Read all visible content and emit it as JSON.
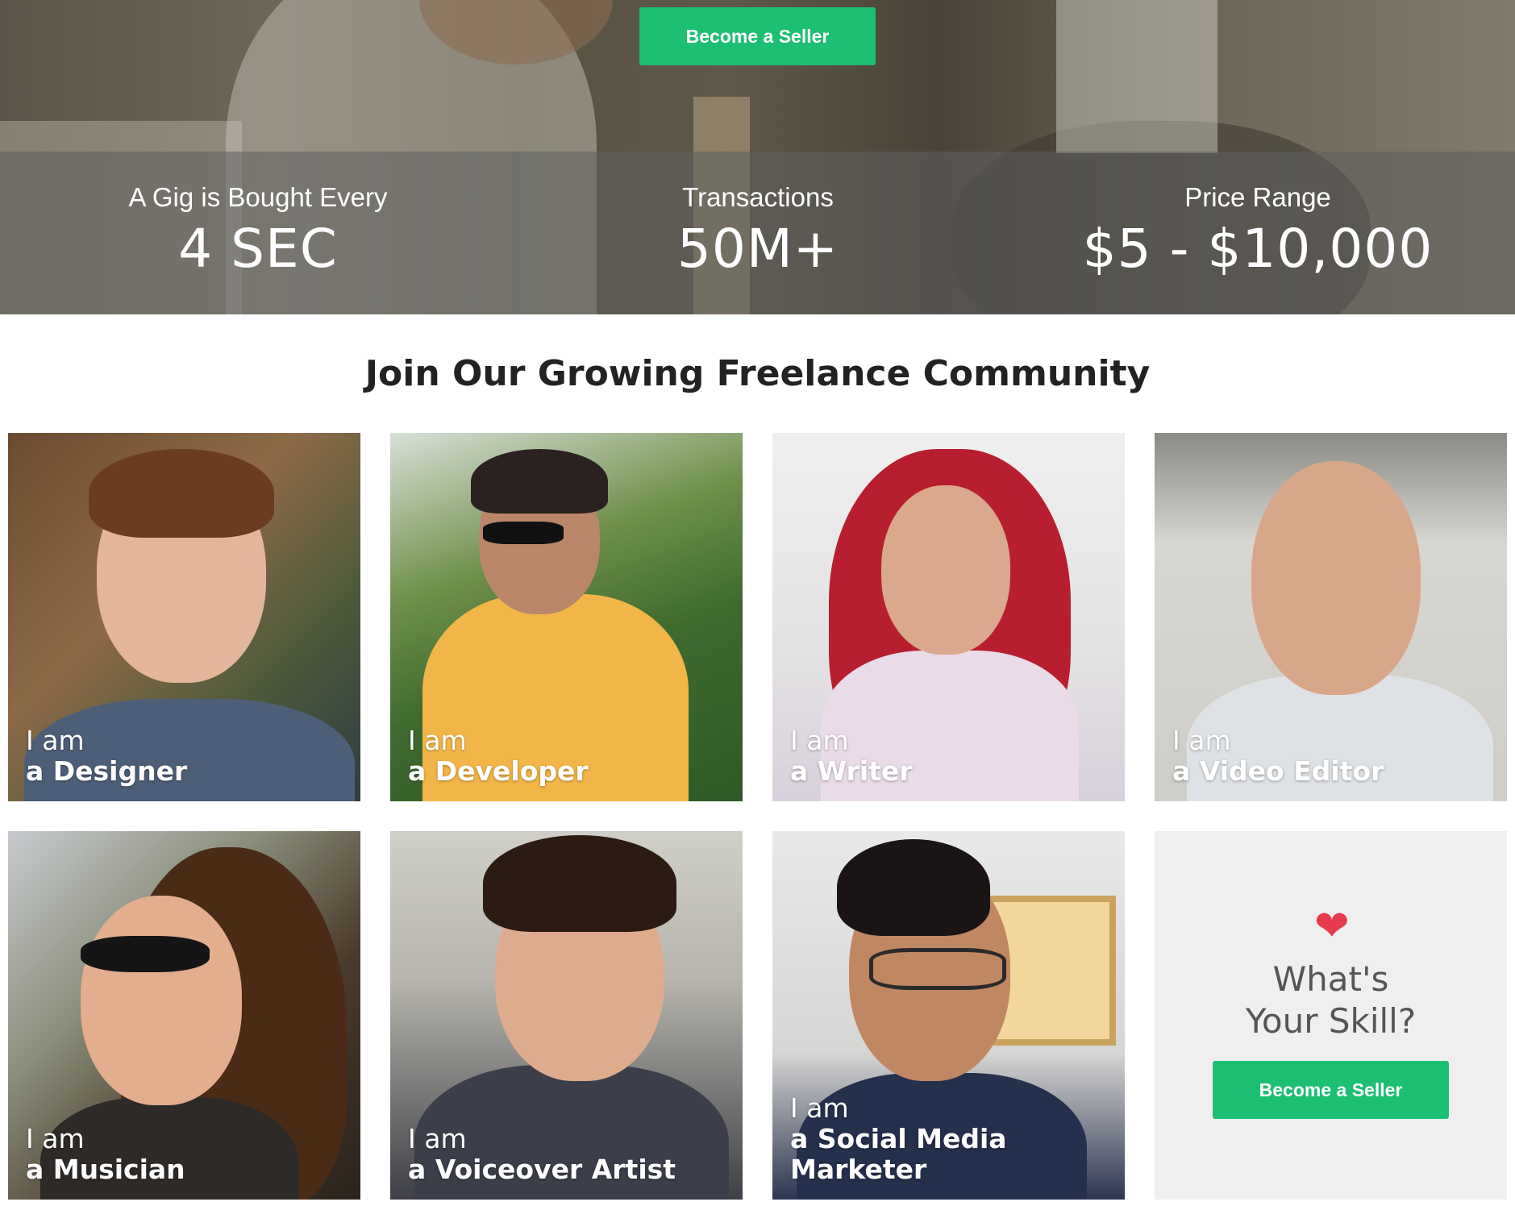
{
  "hero": {
    "cta_label": "Become a Seller",
    "stats": [
      {
        "label": "A Gig is Bought Every",
        "value": "4 SEC"
      },
      {
        "label": "Transactions",
        "value": "50M+"
      },
      {
        "label": "Price Range",
        "value": "$5 - $10,000"
      }
    ]
  },
  "community": {
    "title": "Join Our Growing Freelance Community",
    "cards": [
      {
        "line1": "I am",
        "line2": "a Designer"
      },
      {
        "line1": "I am",
        "line2": "a Developer"
      },
      {
        "line1": "I am",
        "line2": "a Writer"
      },
      {
        "line1": "I am",
        "line2": "a Video Editor"
      },
      {
        "line1": "I am",
        "line2": "a Musician"
      },
      {
        "line1": "I am",
        "line2": "a Voiceover Artist"
      },
      {
        "line1": "I am",
        "line2": "a Social Media Marketer"
      }
    ],
    "cta_card": {
      "question_line1": "What's",
      "question_line2": "Your Skill?",
      "button_label": "Become a Seller",
      "icon": "heart-icon"
    }
  },
  "colors": {
    "accent_green": "#1dbf73",
    "heart_red": "#e63b4d"
  }
}
